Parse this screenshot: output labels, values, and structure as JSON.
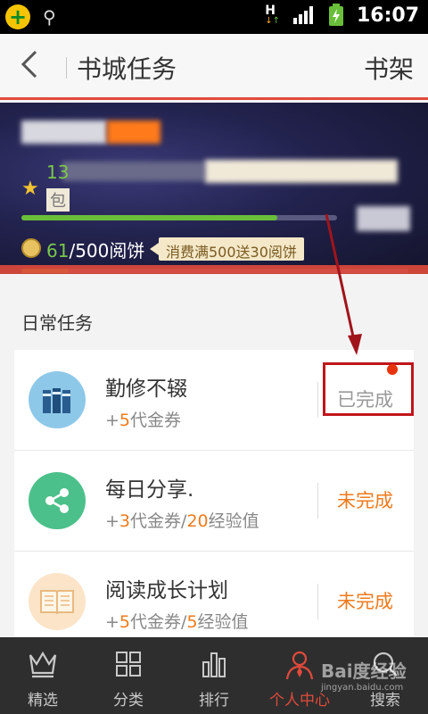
{
  "status_bar": {
    "time": "16:07",
    "network": "H"
  },
  "header": {
    "title": "书城任务",
    "right_button": "书架",
    "back_glyph": "‹"
  },
  "profile": {
    "level_prefix": "13",
    "badge_text": "包",
    "level_progress": 0.81,
    "coins_current": "61",
    "coins_total": "/500阅饼",
    "promo": "消费满500送30阅饼",
    "coins_progress": 0.122
  },
  "section_title": "日常任务",
  "tasks": [
    {
      "name": "勤修不辍",
      "reward_prefix": "+",
      "reward_n1": "5",
      "reward_t1": "代金券",
      "reward_sep": "",
      "reward_n2": "",
      "reward_t2": "",
      "status": "已完成"
    },
    {
      "name": "每日分享.",
      "reward_prefix": "+",
      "reward_n1": "3",
      "reward_t1": "代金券",
      "reward_sep": "/",
      "reward_n2": "20",
      "reward_t2": "经验值",
      "status": "未完成"
    },
    {
      "name": "阅读成长计划",
      "reward_prefix": "+",
      "reward_n1": "5",
      "reward_t1": "代金券",
      "reward_sep": "/",
      "reward_n2": "5",
      "reward_t2": "经验值",
      "status": "未完成"
    }
  ],
  "nav": {
    "items": [
      {
        "label": "精选",
        "icon": "crown-icon"
      },
      {
        "label": "分类",
        "icon": "grid-icon"
      },
      {
        "label": "排行",
        "icon": "bar-chart-icon"
      },
      {
        "label": "个人中心",
        "icon": "person-icon"
      },
      {
        "label": "搜索",
        "icon": "search-icon"
      }
    ],
    "active_index": 3
  },
  "watermark": {
    "text": "Bai度经验",
    "url": "jingyan.baidu.com"
  },
  "colors": {
    "accent": "#e24a3b",
    "orange": "#f07a1c",
    "green": "#6abf3a",
    "nav_bg": "#2e2e2e"
  }
}
